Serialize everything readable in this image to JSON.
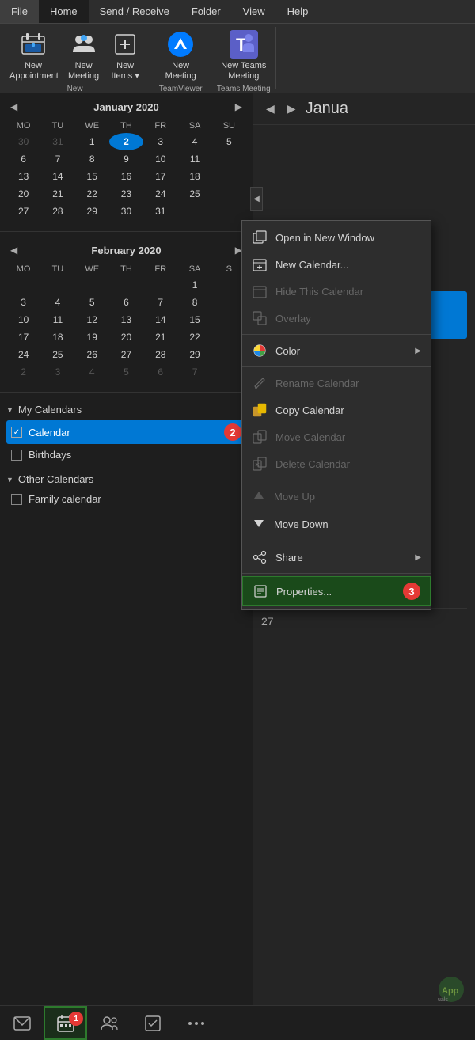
{
  "menuBar": {
    "items": [
      "File",
      "Home",
      "Send / Receive",
      "Folder",
      "View",
      "Help"
    ],
    "activeItem": "Home"
  },
  "ribbon": {
    "groups": [
      {
        "label": "New",
        "items": [
          {
            "id": "new-appointment",
            "icon": "📅",
            "label": "New\nAppointment"
          },
          {
            "id": "new-meeting",
            "icon": "👥",
            "label": "New\nMeeting"
          },
          {
            "id": "new-items",
            "icon": "📋",
            "label": "New\nItems ▾"
          }
        ]
      },
      {
        "label": "TeamViewer",
        "items": [
          {
            "id": "new-meeting-tv",
            "icon": "🖥",
            "label": "New\nMeeting"
          }
        ]
      },
      {
        "label": "Teams Meeting",
        "items": [
          {
            "id": "new-teams-meeting",
            "icon": "🟦",
            "label": "New Teams\nMeeting"
          }
        ]
      }
    ]
  },
  "januaryCalendar": {
    "title": "January 2020",
    "dayHeaders": [
      "MO",
      "TU",
      "WE",
      "TH",
      "FR",
      "SA",
      "SU"
    ],
    "weeks": [
      [
        "30",
        "31",
        "1",
        "2",
        "3",
        "4",
        "5"
      ],
      [
        "6",
        "7",
        "8",
        "9",
        "10",
        "11",
        ""
      ],
      [
        "13",
        "14",
        "15",
        "16",
        "17",
        "18",
        ""
      ],
      [
        "20",
        "21",
        "22",
        "23",
        "24",
        "25",
        ""
      ],
      [
        "27",
        "28",
        "29",
        "30",
        "31",
        "",
        ""
      ]
    ],
    "today": "2",
    "otherMonthDays": [
      "30",
      "31"
    ]
  },
  "februaryCalendar": {
    "title": "February 2020",
    "dayHeaders": [
      "MO",
      "TU",
      "WE",
      "TH",
      "FR",
      "SA",
      "S"
    ],
    "weeks": [
      [
        "",
        "",
        "",
        "",
        "",
        "1",
        ""
      ],
      [
        "3",
        "4",
        "5",
        "6",
        "7",
        "8",
        ""
      ],
      [
        "10",
        "11",
        "12",
        "13",
        "14",
        "15",
        ""
      ],
      [
        "17",
        "18",
        "19",
        "20",
        "21",
        "22",
        ""
      ],
      [
        "24",
        "25",
        "26",
        "27",
        "28",
        "29",
        ""
      ],
      [
        "2",
        "3",
        "4",
        "5",
        "6",
        "7",
        ""
      ]
    ]
  },
  "calendarList": {
    "myCalendars": {
      "label": "My Calendars",
      "items": [
        {
          "id": "calendar",
          "label": "Calendar",
          "checked": true,
          "selected": true
        },
        {
          "id": "birthdays",
          "label": "Birthdays",
          "checked": false,
          "selected": false
        }
      ]
    },
    "otherCalendars": {
      "label": "Other Calendars",
      "items": [
        {
          "id": "family-calendar",
          "label": "Family calendar",
          "checked": false,
          "selected": false
        }
      ]
    }
  },
  "rightPanel": {
    "navPrev": "◀",
    "navNext": "▶",
    "title": "Janua",
    "weekRow27": "27"
  },
  "contextMenu": {
    "items": [
      {
        "id": "open-new-window",
        "icon": "🪟",
        "label": "Open in New Window",
        "disabled": false,
        "arrow": false
      },
      {
        "id": "new-calendar",
        "icon": "📅",
        "label": "New Calendar...",
        "disabled": false,
        "arrow": false
      },
      {
        "id": "hide-calendar",
        "icon": "📅",
        "label": "Hide This Calendar",
        "disabled": true,
        "arrow": false
      },
      {
        "id": "overlay",
        "icon": "📋",
        "label": "Overlay",
        "disabled": true,
        "arrow": false
      },
      {
        "id": "color",
        "icon": "🎨",
        "label": "Color",
        "disabled": false,
        "arrow": true
      },
      {
        "id": "rename-calendar",
        "icon": "✏️",
        "label": "Rename Calendar",
        "disabled": true,
        "arrow": false
      },
      {
        "id": "copy-calendar",
        "icon": "📁",
        "label": "Copy Calendar",
        "disabled": false,
        "arrow": false
      },
      {
        "id": "move-calendar",
        "icon": "📁",
        "label": "Move Calendar",
        "disabled": true,
        "arrow": false
      },
      {
        "id": "delete-calendar",
        "icon": "🗑",
        "label": "Delete Calendar",
        "disabled": true,
        "arrow": false
      },
      {
        "id": "move-up",
        "icon": "▲",
        "label": "Move Up",
        "disabled": true,
        "arrow": false
      },
      {
        "id": "move-down",
        "icon": "▼",
        "label": "Move Down",
        "disabled": false,
        "arrow": false
      },
      {
        "id": "share",
        "icon": "🔗",
        "label": "Share",
        "disabled": false,
        "arrow": true
      },
      {
        "id": "properties",
        "icon": "📄",
        "label": "Properties...",
        "disabled": false,
        "arrow": false,
        "highlighted": true
      }
    ]
  },
  "bottomNav": {
    "items": [
      {
        "id": "mail",
        "icon": "✉",
        "label": "Mail",
        "active": false
      },
      {
        "id": "calendar",
        "icon": "⊞",
        "label": "Calendar",
        "active": true,
        "badge": "1"
      },
      {
        "id": "people",
        "icon": "👤",
        "label": "People",
        "active": false
      },
      {
        "id": "tasks",
        "icon": "✔",
        "label": "Tasks",
        "active": false
      },
      {
        "id": "more",
        "icon": "•••",
        "label": "More",
        "active": false
      }
    ]
  },
  "badges": {
    "badge1": "1",
    "badge2": "2",
    "badge3": "3"
  }
}
